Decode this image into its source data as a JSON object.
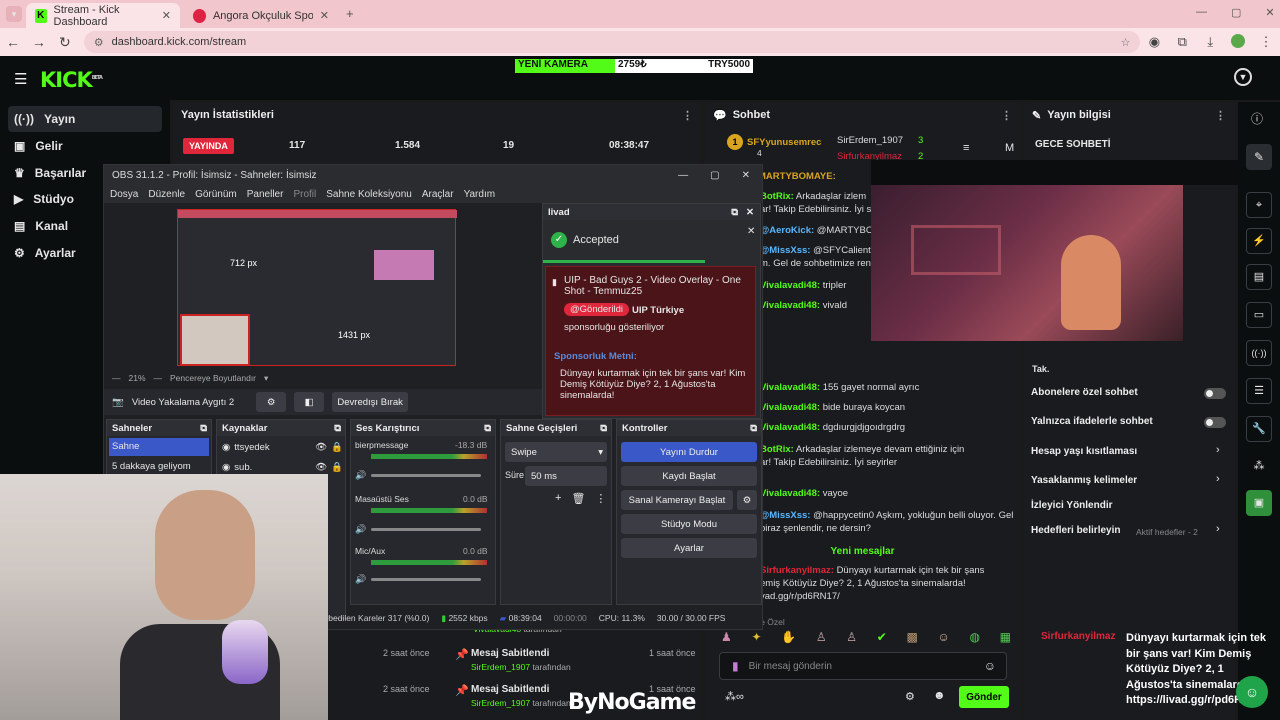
{
  "browser": {
    "tabs": [
      {
        "title": "Stream - Kick Dashboard"
      },
      {
        "title": "Angora Okçuluk Spor Kulübü -"
      }
    ],
    "url": "dashboard.kick.com/stream"
  },
  "kick": {
    "logo": "KICK",
    "beta": "BETA",
    "ticker": {
      "label": "YENİ KAMERA",
      "amount": "2759₺",
      "goal": "TRY5000"
    },
    "nav": [
      {
        "label": "Yayın"
      },
      {
        "label": "Gelir"
      },
      {
        "label": "Başarılar"
      },
      {
        "label": "Stüdyo"
      },
      {
        "label": "Kanal"
      },
      {
        "label": "Ayarlar"
      }
    ],
    "stats": {
      "title": "Yayın İstatistikleri",
      "live": "YAYINDA",
      "values": [
        "117",
        "1.584",
        "19",
        "08:38:47"
      ]
    },
    "chat": {
      "title": "Sohbet",
      "placeholder": "Bir mesaj gönderin",
      "send": "Gönder",
      "new_messages": "Yeni mesajlar",
      "top": [
        {
          "name": "SFYyunusemrec",
          "count": "4"
        },
        {
          "name": "SirErdem_1907",
          "count": "3"
        },
        {
          "name": "Sirfurkanyilmaz",
          "count": "2"
        }
      ]
    },
    "info": {
      "title": "Yayın bilgisi",
      "stream_title": "GECE SOHBETİ",
      "rows": [
        {
          "label": "Abonelere özel sohbet"
        },
        {
          "label": "Yalnızca ifadelerle sohbet"
        },
        {
          "label": "Hesap yaşı kısıtlaması"
        },
        {
          "label": "Yasaklanmış kelimeler"
        },
        {
          "label": "İzleyici Yönlendir"
        },
        {
          "label": "Hedefleri belirleyin"
        }
      ],
      "active_goals": "Aktif hedefler - 2"
    }
  },
  "obs": {
    "title": "OBS 31.1.2 - Profil: İsimsiz - Sahneler: İsimsiz",
    "menu": [
      "Dosya",
      "Düzenle",
      "Görünüm",
      "Paneller",
      "Profil",
      "Sahne Koleksiyonu",
      "Araçlar",
      "Yardım"
    ],
    "zoom": "21%",
    "fit": "Pencereye Boyutlandır",
    "source_name": "Video Yakalama Aygıtı 2",
    "deactivate": "Devredışı Bırak",
    "docks": {
      "scenes": "Sahneler",
      "sources": "Kaynaklar",
      "mixer": "Ses Karıştırıcı",
      "transitions": "Sahne Geçişleri",
      "controls": "Kontroller"
    },
    "scenes": [
      "Sahne",
      "5 dakkaya geliyom"
    ],
    "sources": [
      "ttsyedek",
      "sub."
    ],
    "mixer": [
      {
        "name": "bierpmessage",
        "db": "-18.3 dB"
      },
      {
        "name": "Masaüstü Ses",
        "db": "0.0 dB"
      },
      {
        "name": "Mic/Aux",
        "db": "0.0 dB"
      }
    ],
    "transition": "Swipe",
    "duration_label": "Süre",
    "duration": "50 ms",
    "controls": [
      "Yayını Durdur",
      "Kaydı Başlat",
      "Sanal Kamerayı Başlat",
      "Stüdyo Modu",
      "Ayarlar"
    ],
    "status": {
      "dropped": "ybedilen Kareler 317 (%0.0)",
      "kbps": "2552 kbps",
      "live_time": "08:39:04",
      "rec_time": "00:00:00",
      "cpu": "CPU: 11.3%",
      "fps": "30.00 / 30.00 FPS"
    }
  },
  "livad": {
    "title": "livad",
    "status": "Accepted",
    "offer": "UIP - Bad Guys 2 - Video Overlay - One Shot - Temmuz25",
    "sent": "Gönderildi",
    "brand": "UIP Türkiye",
    "sponsor_note": "sponsorluğu gösteriliyor",
    "text_label": "Sponsorluk Metni:",
    "text": "Dünyayı kurtarmak için tek bir şans var! Kim Demiş Kötüyüz Diye? 2, 1 Ağustos'ta sinemalarda!"
  },
  "chat_lines": [
    {
      "user": "MARTYBOMAYE:",
      "msg": ""
    },
    {
      "user": "BotRix:",
      "msg": "Arkadaşlar izlem"
    },
    {
      "user": "",
      "msg": "ar! Takip Edebilirsiniz. İyi sey"
    },
    {
      "user": "@AeroKick:",
      "msg": "@MARTYBOMA"
    },
    {
      "user": "@MissXss:",
      "msg": "@SFYCalientav"
    },
    {
      "user": "",
      "msg": "m. Gel de sohbetimize renk"
    },
    {
      "user": "Vivalavadi48:",
      "msg": "tripler"
    },
    {
      "user": "Vivalavadi48:",
      "msg": "vivald"
    },
    {
      "user": "Vivalavadi48:",
      "msg": "155 gayet normal ayrıc"
    },
    {
      "user": "Vivalavadi48:",
      "msg": "bide buraya koycan"
    },
    {
      "user": "Vivalavadi48:",
      "msg": "dgdıurgjdjgoıdrgdrg"
    },
    {
      "user": "BotRix:",
      "msg": "Arkadaşlar izlemeye devam ettiğiniz için"
    },
    {
      "user": "",
      "msg": "ar! Takip Edebilirsiniz. İyi seyirler"
    },
    {
      "user": "Vivalavadi48:",
      "msg": "vayoe"
    },
    {
      "user": "@MissXss:",
      "msg": "@happycetin0 Aşkım, yokluğun belli oluyor. Gel"
    },
    {
      "user": "",
      "msg": "biraz şenlendir, ne dersin?"
    },
    {
      "user": "Sirfurkanyilmaz:",
      "msg": "Dünyayı kurtarmak için tek bir şans"
    },
    {
      "user": "",
      "msg": "emiş Kötüyüz Diye? 2, 1 Ağustos'ta sinemalarda!"
    },
    {
      "user": "",
      "msg": "vad.gg/r/pd6RN17/"
    }
  ],
  "pins": [
    {
      "by": "Vivalavadi48",
      "suffix": "tarafından"
    },
    {
      "title": "Mesaj Sabitlendi",
      "by": "SirErdem_1907",
      "suffix": "tarafından",
      "time": "1 saat önce",
      "left_time": "2 saat önce"
    },
    {
      "title": "Mesaj Sabitlendi",
      "by": "SirErdem_1907",
      "suffix": "tarafından",
      "time": "1 saat önce",
      "left_time": "2 saat önce"
    }
  ],
  "overlay": {
    "user": "Sirfurkanyilmaz",
    "msg": "Dünyayı kurtarmak için tek bir şans var! Kim Demiş Kötüyüz Diye? 2, 1 Ağustos'ta sinemalarda! https://livad.gg/r/pd6RN17/",
    "watermark": "ByNoGame"
  },
  "misc": {
    "mod_label": "Tak.",
    "private_label": "ıre Özel",
    "px_a": "712 px",
    "px_b": "1431 px"
  },
  "colors": {
    "kick_green": "#53fc18",
    "live_red": "#e0263a"
  }
}
